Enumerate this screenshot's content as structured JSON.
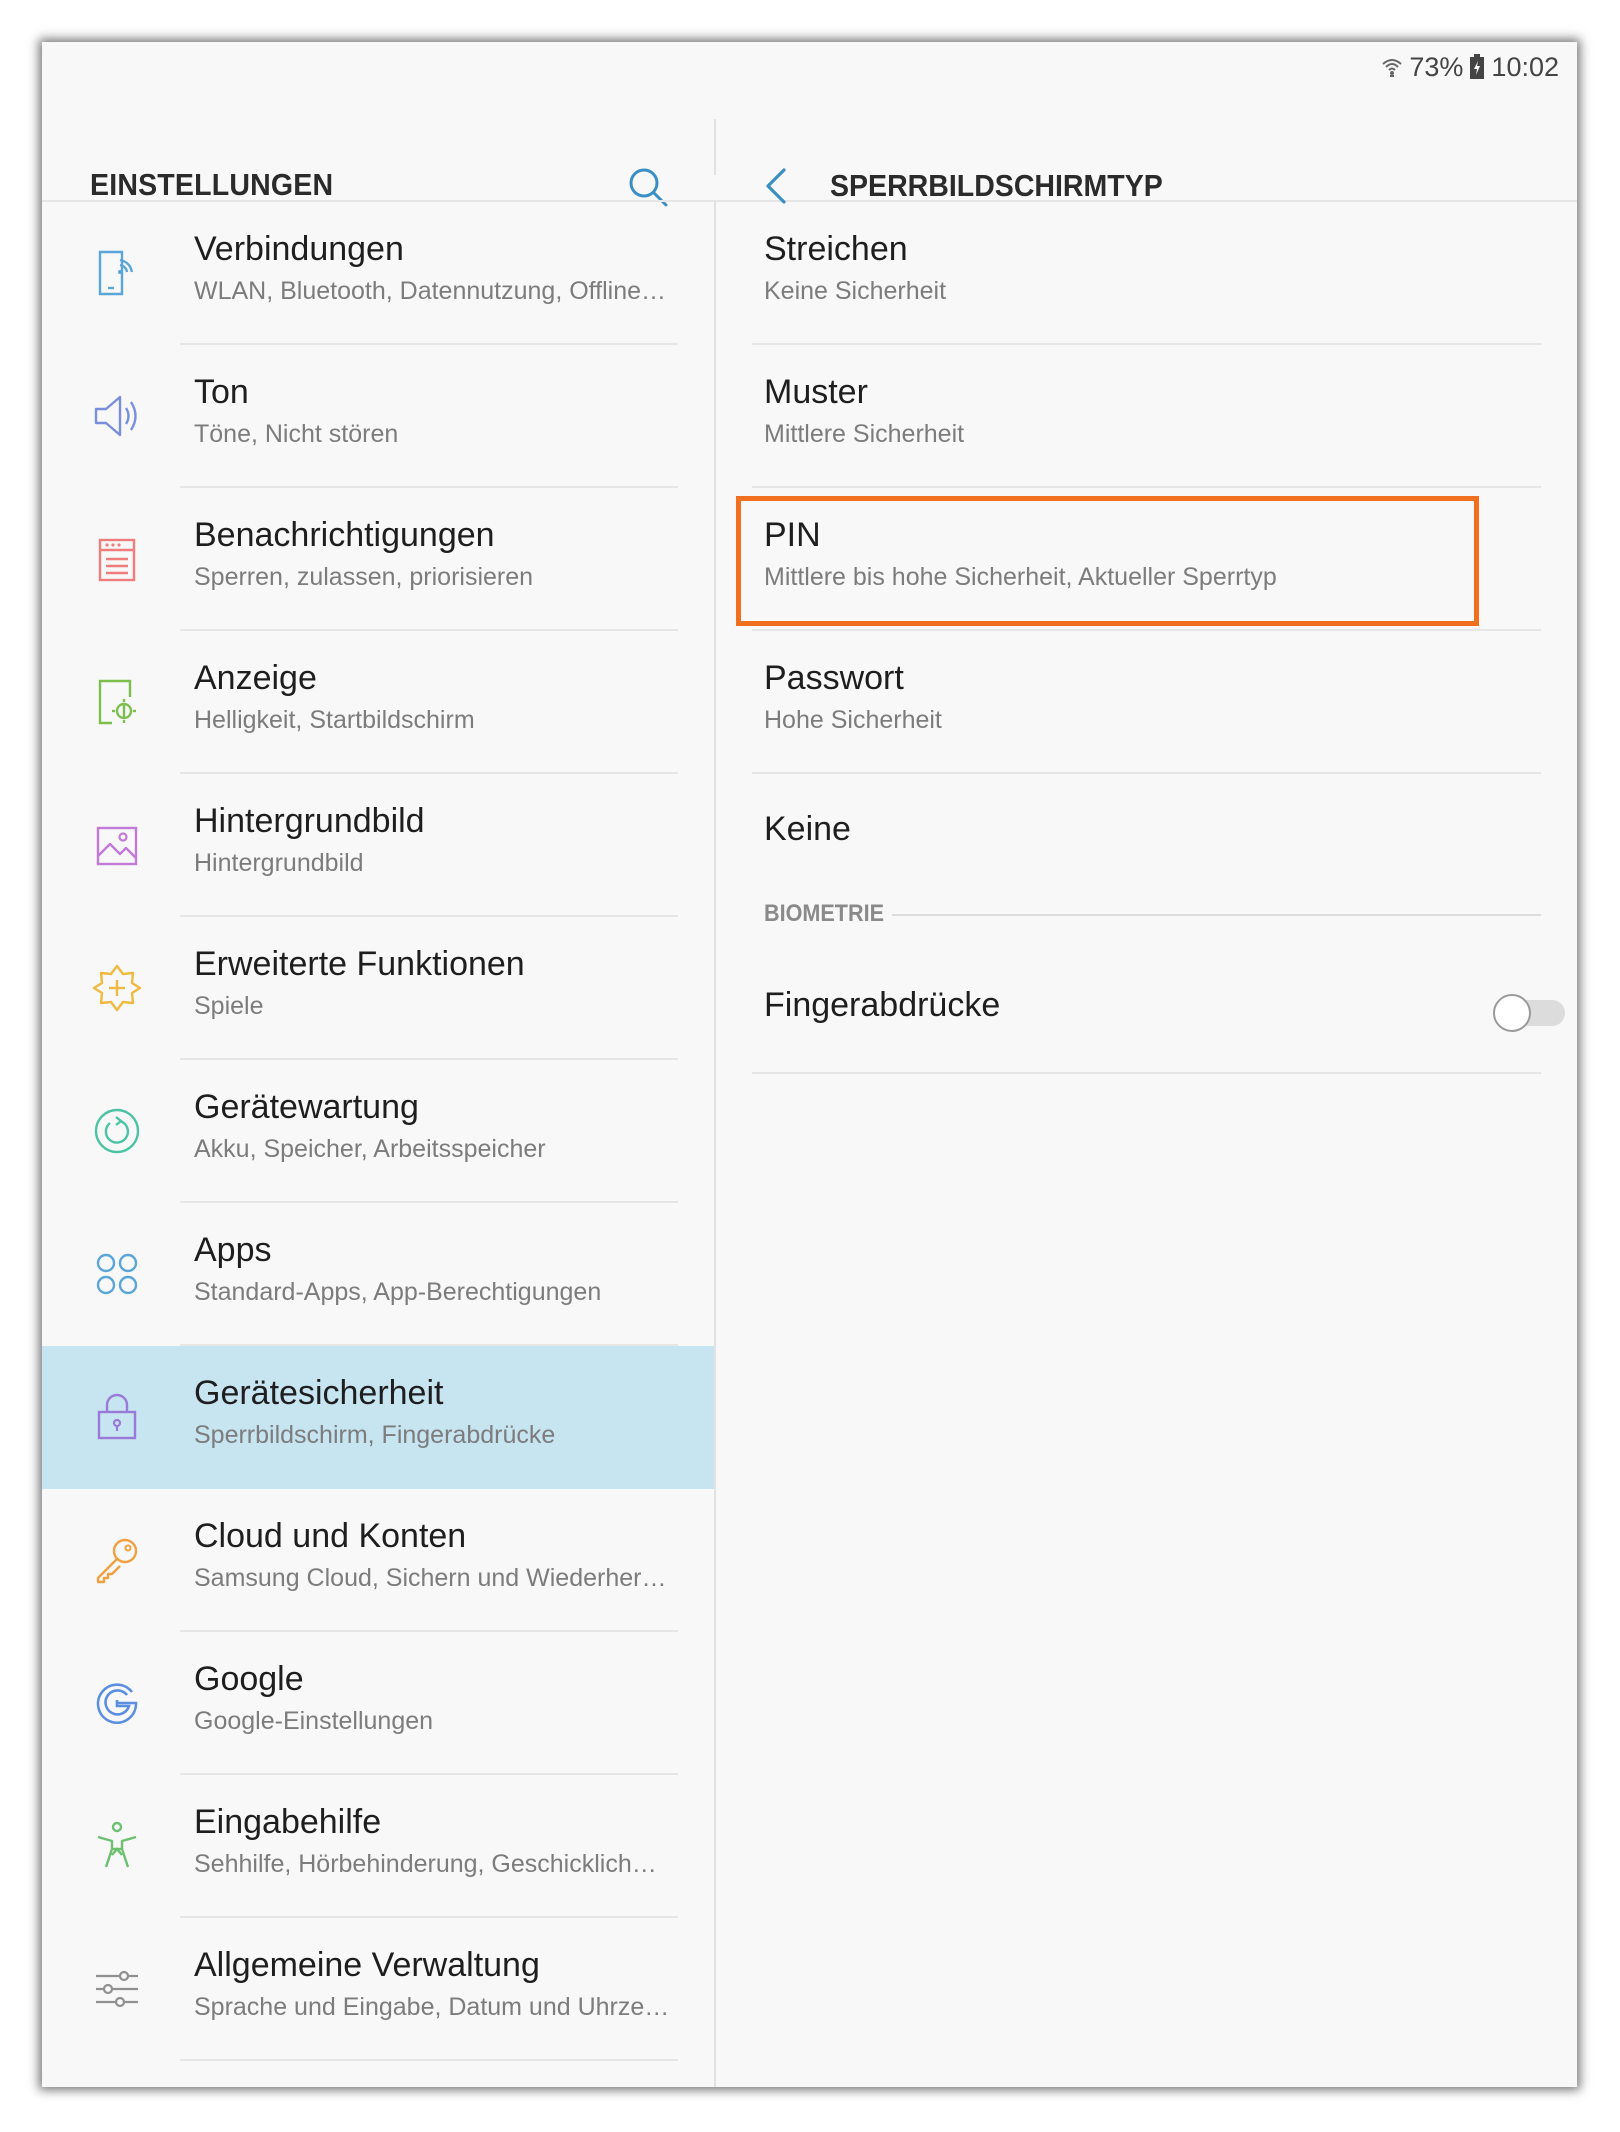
{
  "status_bar": {
    "battery": "73%",
    "time": "10:02"
  },
  "left_pane": {
    "title": "EINSTELLUNGEN",
    "items": [
      {
        "label": "Verbindungen",
        "sub": "WLAN, Bluetooth, Datennutzung, Offline…",
        "icon": "connections-icon",
        "color": "#5aa6d8"
      },
      {
        "label": "Ton",
        "sub": "Töne, Nicht stören",
        "icon": "speaker-icon",
        "color": "#7a8ee0"
      },
      {
        "label": "Benachrichtigungen",
        "sub": "Sperren, zulassen, priorisieren",
        "icon": "notifications-icon",
        "color": "#ef7d7d"
      },
      {
        "label": "Anzeige",
        "sub": "Helligkeit, Startbildschirm",
        "icon": "display-icon",
        "color": "#7cbf4e"
      },
      {
        "label": "Hintergrundbild",
        "sub": "Hintergrundbild",
        "icon": "wallpaper-icon",
        "color": "#c27ad8"
      },
      {
        "label": "Erweiterte Funktionen",
        "sub": "Spiele",
        "icon": "advanced-features-icon",
        "color": "#f0b940"
      },
      {
        "label": "Gerätewartung",
        "sub": "Akku, Speicher, Arbeitsspeicher",
        "icon": "device-care-icon",
        "color": "#4cc4a4"
      },
      {
        "label": "Apps",
        "sub": "Standard-Apps, App-Berechtigungen",
        "icon": "apps-icon",
        "color": "#5aa6d8"
      },
      {
        "label": "Gerätesicherheit",
        "sub": "Sperrbildschirm, Fingerabdrücke",
        "icon": "lock-icon",
        "color": "#9a7ad8",
        "active": true
      },
      {
        "label": "Cloud und Konten",
        "sub": "Samsung Cloud, Sichern und Wiederher…",
        "icon": "key-icon",
        "color": "#f0a040"
      },
      {
        "label": "Google",
        "sub": "Google-Einstellungen",
        "icon": "google-icon",
        "color": "#5a8ee0"
      },
      {
        "label": "Eingabehilfe",
        "sub": "Sehhilfe, Hörbehinderung, Geschicklich…",
        "icon": "accessibility-icon",
        "color": "#6cc070"
      },
      {
        "label": "Allgemeine Verwaltung",
        "sub": "Sprache und Eingabe, Datum und Uhrze…",
        "icon": "sliders-icon",
        "color": "#909090"
      }
    ]
  },
  "right_pane": {
    "title": "SPERRBILDSCHIRMTYP",
    "options": [
      {
        "label": "Streichen",
        "sub": "Keine Sicherheit"
      },
      {
        "label": "Muster",
        "sub": "Mittlere Sicherheit"
      },
      {
        "label": "PIN",
        "sub": "Mittlere bis hohe Sicherheit, Aktueller Sperrtyp",
        "highlighted": true
      },
      {
        "label": "Passwort",
        "sub": "Hohe Sicherheit"
      },
      {
        "label": "Keine",
        "sub": ""
      }
    ],
    "section_title": "BIOMETRIE",
    "fingerprint_label": "Fingerabdrücke",
    "fingerprint_enabled": false
  },
  "colors": {
    "accent": "#3a8fc4",
    "active_bg": "#c7e4f1",
    "highlight_border": "#f07020"
  }
}
